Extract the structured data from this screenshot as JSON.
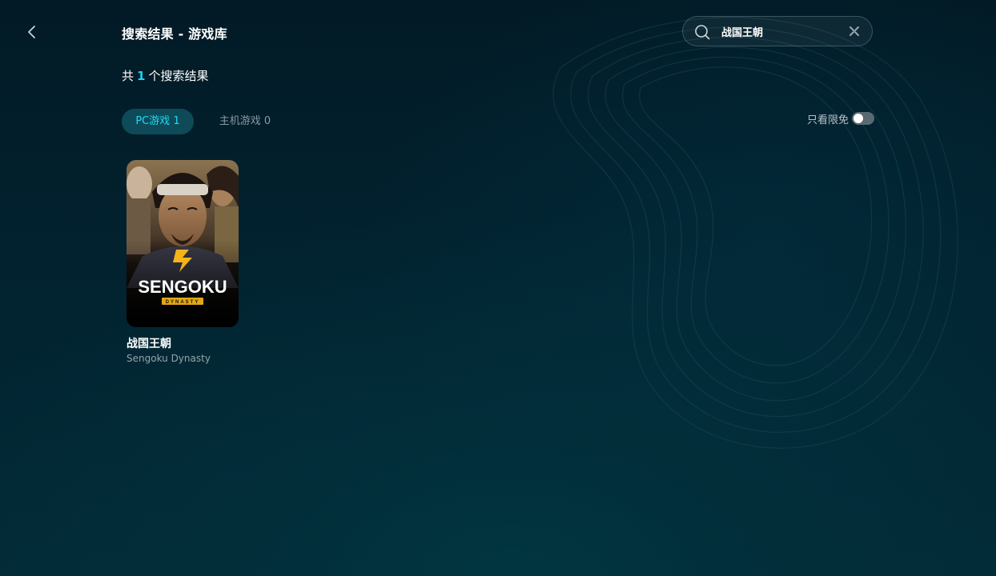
{
  "header": {
    "back_icon": "chevron-left-icon",
    "title": "搜索结果 - 游戏库"
  },
  "search": {
    "icon": "search-icon",
    "value": "战国王朝",
    "clear_icon": "close-icon"
  },
  "results": {
    "prefix": "共",
    "count": "1",
    "suffix": "个搜索结果"
  },
  "tabs": [
    {
      "label": "PC游戏 1",
      "active": true
    },
    {
      "label": "主机游戏 0",
      "active": false
    }
  ],
  "filter": {
    "label": "只看限免",
    "enabled": false
  },
  "games": [
    {
      "title": "战国王朝",
      "subtitle": "Sengoku Dynasty",
      "cover_logo_text": "SENGOKU",
      "cover_logo_sub": "DYNASTY"
    }
  ],
  "colors": {
    "accent": "#1ed3f0",
    "tab_active_bg": "#0f4a58",
    "background": "#021f2c"
  }
}
